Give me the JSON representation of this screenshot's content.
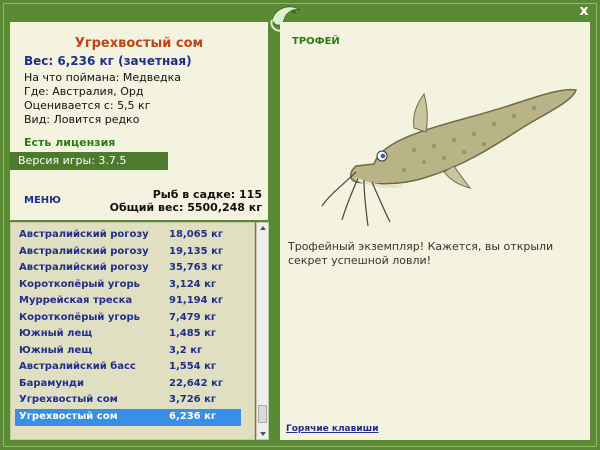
{
  "window": {
    "close_label": "x"
  },
  "info": {
    "fish_name": "Угрехвостый сом",
    "weight_line": "Вес: 6,236 кг (зачетная)",
    "lines": [
      "На что поймана: Медведка",
      "Где: Австралия, Орд",
      "Оценивается с: 5,5 кг",
      "Вид: Ловится редко"
    ],
    "license": "Есть лицензия",
    "version": "Версия игры: 3.7.5"
  },
  "menu": {
    "label": "МЕНЮ",
    "keep_count": "Рыб в садке: 115",
    "total_weight": "Общий вес: 5500,248 кг"
  },
  "catch_list": [
    {
      "name": "Австралийский рогозу...",
      "weight": "18,065 кг"
    },
    {
      "name": "Австралийский рогозу...",
      "weight": "19,135 кг"
    },
    {
      "name": "Австралийский рогозу...",
      "weight": "35,763 кг"
    },
    {
      "name": "Короткопёрый угорь",
      "weight": "3,124 кг"
    },
    {
      "name": "Муррейская треска",
      "weight": "91,194 кг"
    },
    {
      "name": "Короткопёрый угорь",
      "weight": "7,479 кг"
    },
    {
      "name": "Южный лещ",
      "weight": "1,485 кг"
    },
    {
      "name": "Южный лещ",
      "weight": "3,2 кг"
    },
    {
      "name": "Австралийский басс",
      "weight": "1,554 кг"
    },
    {
      "name": "Барамунди",
      "weight": "22,642 кг"
    },
    {
      "name": "Угрехвостый сом",
      "weight": "3,726 кг"
    },
    {
      "name": "Угрехвостый сом",
      "weight": "6,236 кг"
    }
  ],
  "selected_index": 11,
  "trophy": {
    "title": "ТРОФЕЙ",
    "text": "Трофейный экземпляр! Кажется, вы открыли секрет успешной ловли!",
    "hotkeys": "Горячие клавиши"
  }
}
